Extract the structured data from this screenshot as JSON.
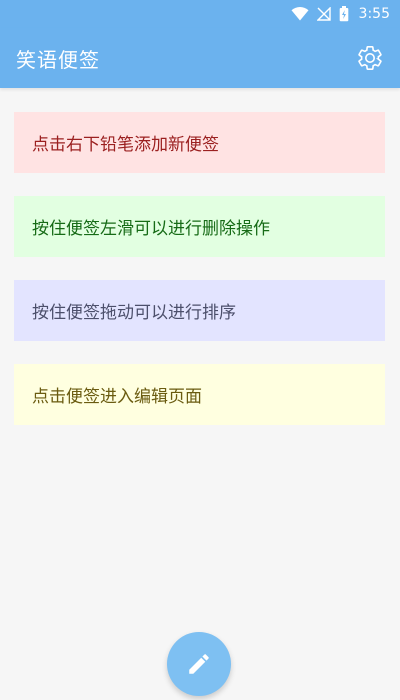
{
  "status_bar": {
    "time": "3:55"
  },
  "app_bar": {
    "title": "笑语便签"
  },
  "notes": [
    {
      "text": "点击右下铅笔添加新便签"
    },
    {
      "text": "按住便签左滑可以进行删除操作"
    },
    {
      "text": "按住便签拖动可以进行排序"
    },
    {
      "text": "点击便签进入编辑页面"
    }
  ],
  "colors": {
    "primary": "#6bb2ee",
    "fab": "#7ec0f2",
    "note_red_bg": "#ffe3e3",
    "note_green_bg": "#e2ffe1",
    "note_blue_bg": "#e3e4ff",
    "note_yellow_bg": "#ffffe0"
  },
  "icons": {
    "status": [
      "wifi-icon",
      "no-signal-icon",
      "battery-charging-icon"
    ],
    "settings": "gear-icon",
    "fab": "pencil-icon"
  }
}
